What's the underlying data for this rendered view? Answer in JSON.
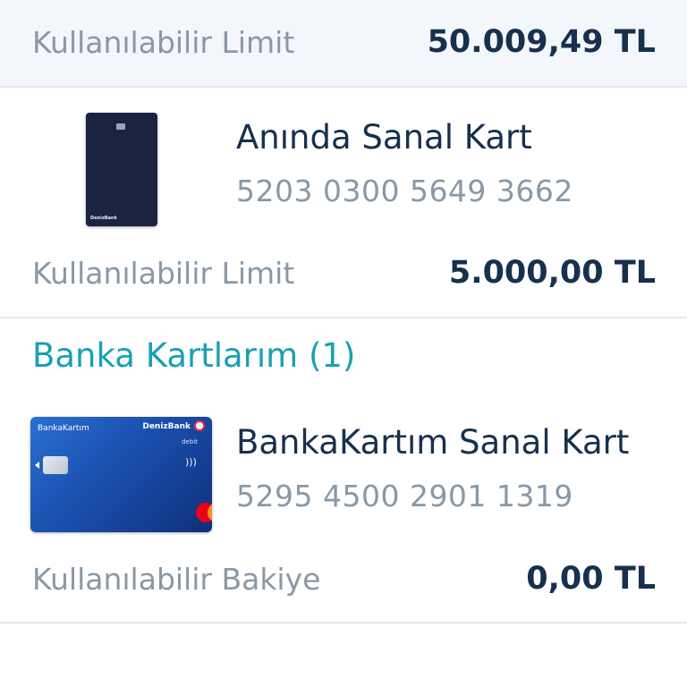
{
  "top_limit": {
    "label": "Kullanılabilir Limit",
    "value": "50.009,49 TL"
  },
  "virtual_card": {
    "title": "Anında Sanal Kart",
    "number": "5203 0300 5649 3662",
    "limit_label": "Kullanılabilir Limit",
    "limit_value": "5.000,00 TL",
    "card_brand_text": "DenizBank"
  },
  "debit_section": {
    "title": "Banka Kartlarım (1)"
  },
  "debit_card": {
    "title": "BankaKartım Sanal Kart",
    "number": "5295 4500 2901 1319",
    "balance_label": "Kullanılabilir Bakiye",
    "balance_value": "0,00 TL",
    "card_product_text": "BankaKartım",
    "card_bank_text": "DenizBank",
    "card_type_text": "debit"
  },
  "colors": {
    "accent": "#1aa0b4",
    "value_text": "#17304d",
    "muted_text": "#8a98a6",
    "limit_bar_bg": "#f3f6fb"
  },
  "icons": [
    "contactless-icon",
    "mastercard-logo-icon",
    "denizbank-logo-icon"
  ]
}
